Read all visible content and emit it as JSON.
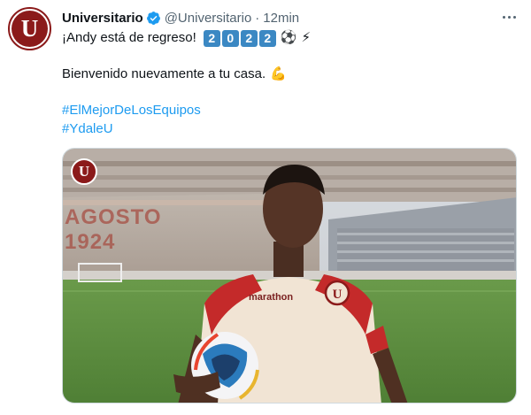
{
  "account": {
    "display_name": "Universitario",
    "handle": "@Universitario",
    "separator": "·",
    "time": "12min",
    "avatar_letter": "U"
  },
  "tweet": {
    "line1_text": "¡Andy está de regreso!",
    "year_digits": [
      "2",
      "0",
      "2",
      "2"
    ],
    "emoji_ball": "⚽",
    "emoji_bolt": "⚡",
    "line2_text": "Bienvenido nuevamente a tu casa.",
    "emoji_muscle": "💪",
    "hashtags": [
      "#ElMejorDeLosEquipos",
      "#YdaleU"
    ]
  },
  "media": {
    "stand_text_line1": "AGOSTO",
    "stand_text_line2": "1924",
    "shirt_brand": "marathon",
    "logo_letter": "U"
  },
  "icons": {
    "verified": "verified-badge-icon",
    "more": "more-options-icon"
  },
  "colors": {
    "brand_red": "#8b1a1a",
    "link_blue": "#1d9bf0",
    "muted_gray": "#536471",
    "verified_blue": "#1d9bf0"
  }
}
